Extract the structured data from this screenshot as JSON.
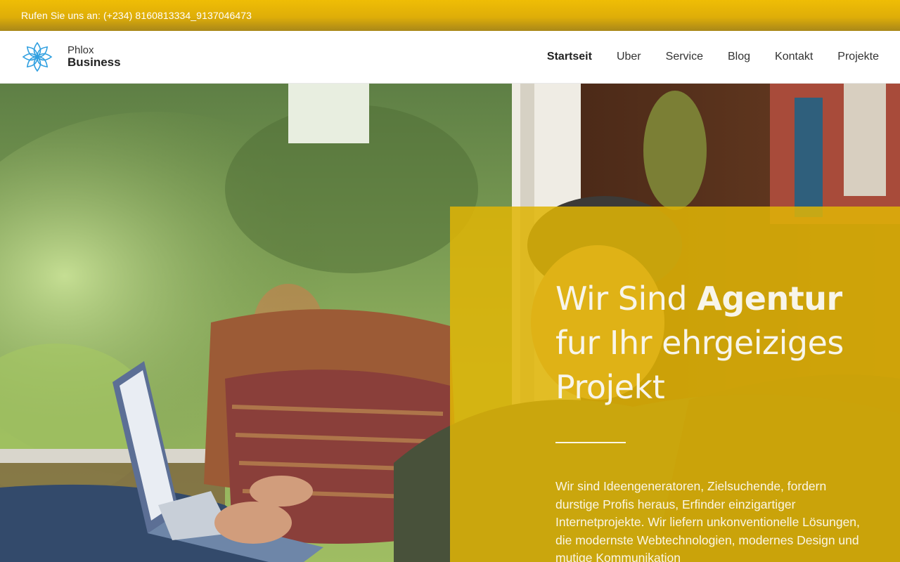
{
  "topbar": {
    "contact_text": "Rufen Sie uns an: (+234) 8160813334_9137046473"
  },
  "logo": {
    "line1": "Phlox",
    "line2": "Business",
    "icon": "flower-icon"
  },
  "nav": {
    "items": [
      {
        "label": "Startseit",
        "active": true
      },
      {
        "label": "Uber"
      },
      {
        "label": "Service"
      },
      {
        "label": "Blog"
      },
      {
        "label": "Kontakt"
      },
      {
        "label": "Projekte"
      }
    ]
  },
  "hero": {
    "headline_part1": "Wir Sind ",
    "headline_bold": "Agentur",
    "headline_part2": "fur Ihr ehrgeiziges",
    "headline_part3": "Projekt",
    "paragraph": "Wir sind Ideengeneratoren, Zielsuchende, fordern durstige Profis heraus, Erfinder einzigartiger Internetprojekte. Wir liefern unkonventionelle Lösungen, die modernste Webtechnologien, modernes Design und mutige Kommunikation"
  },
  "colors": {
    "accent": "#dfb506",
    "topbar": "#e4b305",
    "text_dark": "#333333"
  }
}
